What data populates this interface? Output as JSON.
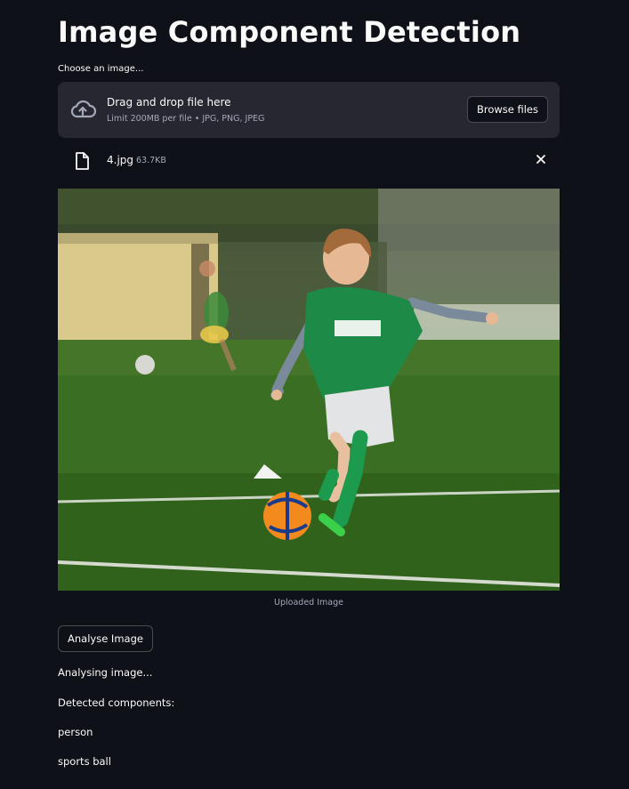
{
  "page": {
    "title": "Image Component Detection"
  },
  "uploader": {
    "label": "Choose an image...",
    "drop_title": "Drag and drop file here",
    "drop_limit": "Limit 200MB per file • JPG, PNG, JPEG",
    "browse_label": "Browse files",
    "icon": "cloud-upload-icon"
  },
  "file": {
    "name": "4.jpg",
    "size": "63.7KB",
    "icon": "file-icon",
    "remove_icon": "close-icon"
  },
  "image": {
    "caption": "Uploaded Image"
  },
  "actions": {
    "analyse_label": "Analyse Image"
  },
  "results": {
    "status": "Analysing image...",
    "heading": "Detected components:",
    "items": [
      "person",
      "sports ball"
    ]
  },
  "colors": {
    "background": "#0e1117",
    "surface": "#262730",
    "text": "#fafafa",
    "muted": "#a3a8b8"
  }
}
